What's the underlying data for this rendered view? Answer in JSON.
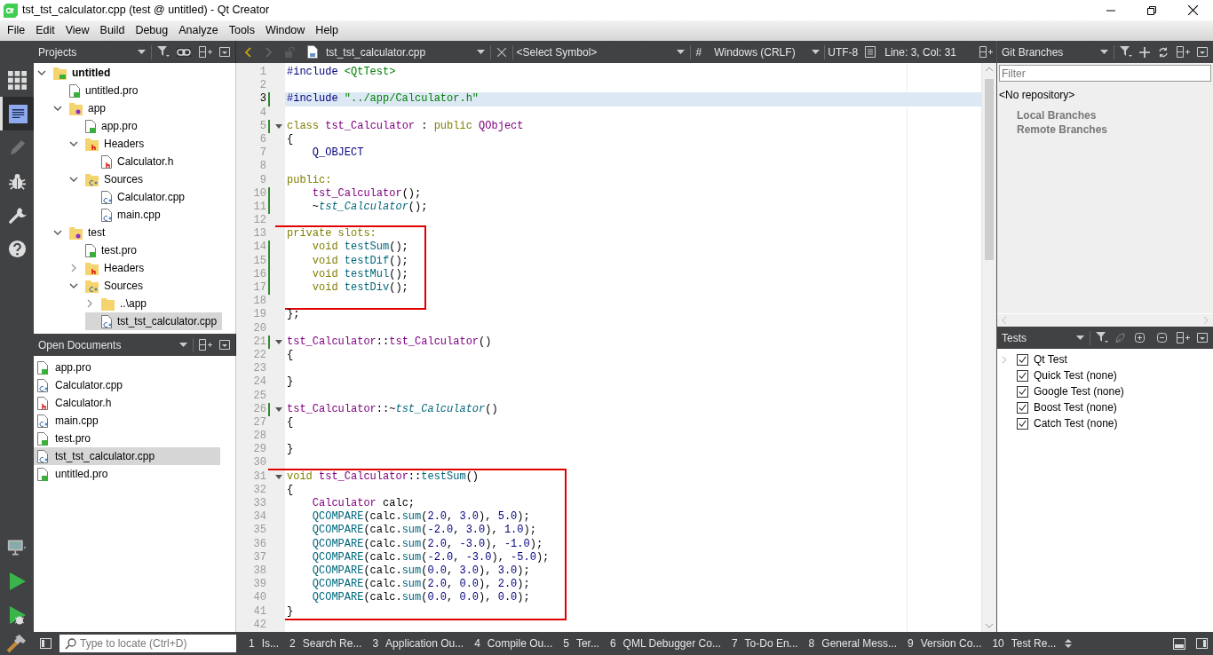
{
  "window": {
    "title": "tst_tst_calculator.cpp (test @ untitled) - Qt Creator"
  },
  "menu": [
    "File",
    "Edit",
    "View",
    "Build",
    "Debug",
    "Analyze",
    "Tools",
    "Window",
    "Help"
  ],
  "mode_bar": [
    {
      "kind": "welcome",
      "selected": false,
      "disabled": false
    },
    {
      "kind": "edit",
      "selected": true,
      "disabled": false
    },
    {
      "kind": "design",
      "selected": false,
      "disabled": true
    },
    {
      "kind": "debug",
      "selected": false,
      "disabled": false
    },
    {
      "kind": "projects",
      "selected": false,
      "disabled": false
    },
    {
      "kind": "help",
      "selected": false,
      "disabled": false
    }
  ],
  "projects": {
    "title": "Projects",
    "tree": [
      {
        "label": "untitled",
        "kind": "project",
        "bold": true,
        "expanded": true,
        "selected": false,
        "children": [
          {
            "label": "untitled.pro",
            "kind": "pro",
            "selected": false
          },
          {
            "label": "app",
            "kind": "subproject",
            "expanded": true,
            "selected": false,
            "children": [
              {
                "label": "app.pro",
                "kind": "pro",
                "selected": false
              },
              {
                "label": "Headers",
                "kind": "folder-h",
                "expanded": true,
                "selected": false,
                "children": [
                  {
                    "label": "Calculator.h",
                    "kind": "h",
                    "selected": false
                  }
                ]
              },
              {
                "label": "Sources",
                "kind": "folder-cpp",
                "expanded": true,
                "selected": false,
                "children": [
                  {
                    "label": "Calculator.cpp",
                    "kind": "cpp",
                    "selected": false
                  },
                  {
                    "label": "main.cpp",
                    "kind": "cpp",
                    "selected": false
                  }
                ]
              }
            ]
          },
          {
            "label": "test",
            "kind": "subproject",
            "expanded": true,
            "selected": false,
            "children": [
              {
                "label": "test.pro",
                "kind": "pro",
                "selected": false
              },
              {
                "label": "Headers",
                "kind": "folder-h",
                "expanded": false,
                "selected": false
              },
              {
                "label": "Sources",
                "kind": "folder-cpp",
                "expanded": true,
                "selected": false,
                "children": [
                  {
                    "label": "..\\app",
                    "kind": "folder",
                    "expanded": false,
                    "selected": false
                  },
                  {
                    "label": "tst_tst_calculator.cpp",
                    "kind": "cpp",
                    "selected": true
                  }
                ]
              }
            ]
          }
        ]
      }
    ]
  },
  "open_documents": {
    "title": "Open Documents",
    "items": [
      {
        "label": "app.pro",
        "kind": "pro",
        "selected": false
      },
      {
        "label": "Calculator.cpp",
        "kind": "cpp",
        "selected": false
      },
      {
        "label": "Calculator.h",
        "kind": "h",
        "selected": false
      },
      {
        "label": "main.cpp",
        "kind": "cpp",
        "selected": false
      },
      {
        "label": "test.pro",
        "kind": "pro",
        "selected": false
      },
      {
        "label": "tst_tst_calculator.cpp",
        "kind": "cpp",
        "selected": true
      },
      {
        "label": "untitled.pro",
        "kind": "pro",
        "selected": false
      }
    ]
  },
  "editor_toolbar": {
    "file": "tst_tst_calculator.cpp",
    "symbol": "<Select Symbol>",
    "hash": "#",
    "line_endings": "Windows (CRLF)",
    "encoding": "UTF-8",
    "position": "Line: 3, Col: 31"
  },
  "editor": {
    "blocks": [
      {
        "boxed": false,
        "lines": [
          {
            "number": "1",
            "modified": false,
            "fold": false,
            "current": false,
            "tokens": [
              {
                "kind": "pp",
                "text": "#include"
              },
              {
                "kind": "inc",
                "text": " <QtTest>"
              }
            ]
          },
          {
            "number": "2",
            "modified": false,
            "fold": false,
            "current": false
          },
          {
            "number": "3",
            "modified": true,
            "fold": false,
            "current": true,
            "tokens": [
              {
                "kind": "pp",
                "text": "#include"
              },
              {
                "kind": "inc",
                "text": " \"../app/Calculator.h\""
              }
            ]
          },
          {
            "number": "4",
            "modified": false,
            "fold": false,
            "current": false
          },
          {
            "number": "5",
            "modified": true,
            "fold": true,
            "current": false,
            "tokens": [
              {
                "kind": "kw",
                "text": "class"
              },
              {
                "kind": "type",
                "text": " tst_Calculator"
              },
              {
                "kind": "txt",
                "text": " : "
              },
              {
                "kind": "kw",
                "text": "public"
              },
              {
                "kind": "type",
                "text": " QObject"
              }
            ]
          },
          {
            "number": "6",
            "modified": false,
            "fold": false,
            "current": false,
            "tokens": [
              {
                "kind": "txt",
                "text": "{"
              }
            ]
          },
          {
            "number": "7",
            "modified": false,
            "fold": false,
            "current": false,
            "tokens": [
              {
                "kind": "macro",
                "text": "    Q_OBJECT"
              }
            ]
          },
          {
            "number": "8",
            "modified": false,
            "fold": false,
            "current": false
          },
          {
            "number": "9",
            "modified": false,
            "fold": false,
            "current": false,
            "tokens": [
              {
                "kind": "kw",
                "text": "public:"
              }
            ]
          },
          {
            "number": "10",
            "modified": true,
            "fold": false,
            "current": false,
            "tokens": [
              {
                "kind": "type",
                "text": "    tst_Calculator"
              },
              {
                "kind": "txt",
                "text": "();"
              }
            ]
          },
          {
            "number": "11",
            "modified": true,
            "fold": false,
            "current": false,
            "tokens": [
              {
                "kind": "txt",
                "text": "    ~"
              },
              {
                "kind": "typeit",
                "text": "tst_Calculator"
              },
              {
                "kind": "txt",
                "text": "();"
              }
            ]
          },
          {
            "number": "12",
            "modified": false,
            "fold": false,
            "current": false
          }
        ]
      },
      {
        "boxed": true,
        "lines": [
          {
            "number": "13",
            "modified": false,
            "fold": false,
            "current": false,
            "tokens": [
              {
                "kind": "kw",
                "text": "private slots:"
              }
            ]
          },
          {
            "number": "14",
            "modified": true,
            "fold": false,
            "current": false,
            "tokens": [
              {
                "kind": "kw",
                "text": "    void"
              },
              {
                "kind": "fn",
                "text": " testSum"
              },
              {
                "kind": "txt",
                "text": "();"
              }
            ]
          },
          {
            "number": "15",
            "modified": true,
            "fold": false,
            "current": false,
            "tokens": [
              {
                "kind": "kw",
                "text": "    void"
              },
              {
                "kind": "fn",
                "text": " testDif"
              },
              {
                "kind": "txt",
                "text": "();"
              }
            ]
          },
          {
            "number": "16",
            "modified": true,
            "fold": false,
            "current": false,
            "tokens": [
              {
                "kind": "kw",
                "text": "    void"
              },
              {
                "kind": "fn",
                "text": " testMul"
              },
              {
                "kind": "txt",
                "text": "();"
              }
            ]
          },
          {
            "number": "17",
            "modified": true,
            "fold": false,
            "current": false,
            "tokens": [
              {
                "kind": "kw",
                "text": "    void"
              },
              {
                "kind": "fn",
                "text": " testDiv"
              },
              {
                "kind": "txt",
                "text": "();"
              }
            ]
          },
          {
            "number": "18",
            "modified": false,
            "fold": false,
            "current": false
          }
        ]
      },
      {
        "boxed": false,
        "lines": [
          {
            "number": "19",
            "modified": false,
            "fold": false,
            "current": false,
            "tokens": [
              {
                "kind": "txt",
                "text": "};"
              }
            ]
          },
          {
            "number": "20",
            "modified": false,
            "fold": false,
            "current": false
          },
          {
            "number": "21",
            "modified": true,
            "fold": true,
            "current": false,
            "tokens": [
              {
                "kind": "type",
                "text": "tst_Calculator"
              },
              {
                "kind": "txt",
                "text": "::"
              },
              {
                "kind": "type",
                "text": "tst_Calculator"
              },
              {
                "kind": "txt",
                "text": "()"
              }
            ]
          },
          {
            "number": "22",
            "modified": false,
            "fold": false,
            "current": false,
            "tokens": [
              {
                "kind": "txt",
                "text": "{"
              }
            ]
          },
          {
            "number": "23",
            "modified": false,
            "fold": false,
            "current": false
          },
          {
            "number": "24",
            "modified": false,
            "fold": false,
            "current": false,
            "tokens": [
              {
                "kind": "txt",
                "text": "}"
              }
            ]
          },
          {
            "number": "25",
            "modified": false,
            "fold": false,
            "current": false
          },
          {
            "number": "26",
            "modified": true,
            "fold": true,
            "current": false,
            "tokens": [
              {
                "kind": "type",
                "text": "tst_Calculator"
              },
              {
                "kind": "txt",
                "text": "::~"
              },
              {
                "kind": "typeit",
                "text": "tst_Calculator"
              },
              {
                "kind": "txt",
                "text": "()"
              }
            ]
          },
          {
            "number": "27",
            "modified": false,
            "fold": false,
            "current": false,
            "tokens": [
              {
                "kind": "txt",
                "text": "{"
              }
            ]
          },
          {
            "number": "28",
            "modified": false,
            "fold": false,
            "current": false
          },
          {
            "number": "29",
            "modified": false,
            "fold": false,
            "current": false,
            "tokens": [
              {
                "kind": "txt",
                "text": "}"
              }
            ]
          },
          {
            "number": "30",
            "modified": false,
            "fold": false,
            "current": false
          }
        ]
      },
      {
        "boxed": true,
        "lines": [
          {
            "number": "31",
            "modified": false,
            "fold": true,
            "current": false,
            "tokens": [
              {
                "kind": "kw",
                "text": "void"
              },
              {
                "kind": "type",
                "text": " tst_Calculator"
              },
              {
                "kind": "txt",
                "text": "::"
              },
              {
                "kind": "fn",
                "text": "testSum"
              },
              {
                "kind": "txt",
                "text": "()"
              }
            ]
          },
          {
            "number": "32",
            "modified": false,
            "fold": false,
            "current": false,
            "tokens": [
              {
                "kind": "txt",
                "text": "{"
              }
            ]
          },
          {
            "number": "33",
            "modified": false,
            "fold": false,
            "current": false,
            "tokens": [
              {
                "kind": "type",
                "text": "    Calculator"
              },
              {
                "kind": "txt",
                "text": " calc;"
              }
            ]
          },
          {
            "number": "34",
            "modified": false,
            "fold": false,
            "current": false,
            "tokens": [
              {
                "kind": "fn",
                "text": "    QCOMPARE"
              },
              {
                "kind": "txt",
                "text": "(calc."
              },
              {
                "kind": "fn",
                "text": "sum"
              },
              {
                "kind": "txt",
                "text": "("
              },
              {
                "kind": "num",
                "text": "2.0"
              },
              {
                "kind": "txt",
                "text": ", "
              },
              {
                "kind": "num",
                "text": "3.0"
              },
              {
                "kind": "txt",
                "text": "), "
              },
              {
                "kind": "num",
                "text": "5.0"
              },
              {
                "kind": "txt",
                "text": ");"
              }
            ]
          },
          {
            "number": "35",
            "modified": false,
            "fold": false,
            "current": false,
            "tokens": [
              {
                "kind": "fn",
                "text": "    QCOMPARE"
              },
              {
                "kind": "txt",
                "text": "(calc."
              },
              {
                "kind": "fn",
                "text": "sum"
              },
              {
                "kind": "txt",
                "text": "("
              },
              {
                "kind": "num",
                "text": "-2.0"
              },
              {
                "kind": "txt",
                "text": ", "
              },
              {
                "kind": "num",
                "text": "3.0"
              },
              {
                "kind": "txt",
                "text": "), "
              },
              {
                "kind": "num",
                "text": "1.0"
              },
              {
                "kind": "txt",
                "text": ");"
              }
            ]
          },
          {
            "number": "36",
            "modified": false,
            "fold": false,
            "current": false,
            "tokens": [
              {
                "kind": "fn",
                "text": "    QCOMPARE"
              },
              {
                "kind": "txt",
                "text": "(calc."
              },
              {
                "kind": "fn",
                "text": "sum"
              },
              {
                "kind": "txt",
                "text": "("
              },
              {
                "kind": "num",
                "text": "2.0"
              },
              {
                "kind": "txt",
                "text": ", "
              },
              {
                "kind": "num",
                "text": "-3.0"
              },
              {
                "kind": "txt",
                "text": "), "
              },
              {
                "kind": "num",
                "text": "-1.0"
              },
              {
                "kind": "txt",
                "text": ");"
              }
            ]
          },
          {
            "number": "37",
            "modified": false,
            "fold": false,
            "current": false,
            "tokens": [
              {
                "kind": "fn",
                "text": "    QCOMPARE"
              },
              {
                "kind": "txt",
                "text": "(calc."
              },
              {
                "kind": "fn",
                "text": "sum"
              },
              {
                "kind": "txt",
                "text": "("
              },
              {
                "kind": "num",
                "text": "-2.0"
              },
              {
                "kind": "txt",
                "text": ", "
              },
              {
                "kind": "num",
                "text": "-3.0"
              },
              {
                "kind": "txt",
                "text": "), "
              },
              {
                "kind": "num",
                "text": "-5.0"
              },
              {
                "kind": "txt",
                "text": ");"
              }
            ]
          },
          {
            "number": "38",
            "modified": false,
            "fold": false,
            "current": false,
            "tokens": [
              {
                "kind": "fn",
                "text": "    QCOMPARE"
              },
              {
                "kind": "txt",
                "text": "(calc."
              },
              {
                "kind": "fn",
                "text": "sum"
              },
              {
                "kind": "txt",
                "text": "("
              },
              {
                "kind": "num",
                "text": "0.0"
              },
              {
                "kind": "txt",
                "text": ", "
              },
              {
                "kind": "num",
                "text": "3.0"
              },
              {
                "kind": "txt",
                "text": "), "
              },
              {
                "kind": "num",
                "text": "3.0"
              },
              {
                "kind": "txt",
                "text": ");"
              }
            ]
          },
          {
            "number": "39",
            "modified": false,
            "fold": false,
            "current": false,
            "tokens": [
              {
                "kind": "fn",
                "text": "    QCOMPARE"
              },
              {
                "kind": "txt",
                "text": "(calc."
              },
              {
                "kind": "fn",
                "text": "sum"
              },
              {
                "kind": "txt",
                "text": "("
              },
              {
                "kind": "num",
                "text": "2.0"
              },
              {
                "kind": "txt",
                "text": ", "
              },
              {
                "kind": "num",
                "text": "0.0"
              },
              {
                "kind": "txt",
                "text": "), "
              },
              {
                "kind": "num",
                "text": "2.0"
              },
              {
                "kind": "txt",
                "text": ");"
              }
            ]
          },
          {
            "number": "40",
            "modified": false,
            "fold": false,
            "current": false,
            "tokens": [
              {
                "kind": "fn",
                "text": "    QCOMPARE"
              },
              {
                "kind": "txt",
                "text": "(calc."
              },
              {
                "kind": "fn",
                "text": "sum"
              },
              {
                "kind": "txt",
                "text": "("
              },
              {
                "kind": "num",
                "text": "0.0"
              },
              {
                "kind": "txt",
                "text": ", "
              },
              {
                "kind": "num",
                "text": "0.0"
              },
              {
                "kind": "txt",
                "text": "), "
              },
              {
                "kind": "num",
                "text": "0.0"
              },
              {
                "kind": "txt",
                "text": ");"
              }
            ]
          },
          {
            "number": "41",
            "modified": false,
            "fold": false,
            "current": false,
            "tokens": [
              {
                "kind": "txt",
                "text": "}"
              }
            ]
          }
        ]
      },
      {
        "boxed": false,
        "lines": [
          {
            "number": "42",
            "modified": false,
            "fold": false,
            "current": false
          }
        ]
      }
    ]
  },
  "git_branches": {
    "title": "Git Branches",
    "filter_placeholder": "Filter",
    "repository": "<No repository>",
    "branches": [
      "Local Branches",
      "Remote Branches"
    ]
  },
  "tests": {
    "title": "Tests",
    "items": [
      {
        "label": "Qt Test",
        "checked": true,
        "expandable": true
      },
      {
        "label": "Quick Test (none)",
        "checked": true,
        "expandable": false
      },
      {
        "label": "Google Test (none)",
        "checked": true,
        "expandable": false
      },
      {
        "label": "Boost Test (none)",
        "checked": true,
        "expandable": false
      },
      {
        "label": "Catch Test (none)",
        "checked": true,
        "expandable": false
      }
    ]
  },
  "status_bar": {
    "locate_placeholder": "Type to locate (Ctrl+D)",
    "panes": [
      {
        "number": "1",
        "label": "Is..."
      },
      {
        "number": "2",
        "label": "Search Re..."
      },
      {
        "number": "3",
        "label": "Application Ou..."
      },
      {
        "number": "4",
        "label": "Compile Ou..."
      },
      {
        "number": "5",
        "label": "Ter..."
      },
      {
        "number": "6",
        "label": "QML Debugger Co..."
      },
      {
        "number": "7",
        "label": "To-Do En..."
      },
      {
        "number": "8",
        "label": "General Mess..."
      },
      {
        "number": "9",
        "label": "Version Co..."
      },
      {
        "number": "10",
        "label": "Test Re..."
      }
    ]
  }
}
